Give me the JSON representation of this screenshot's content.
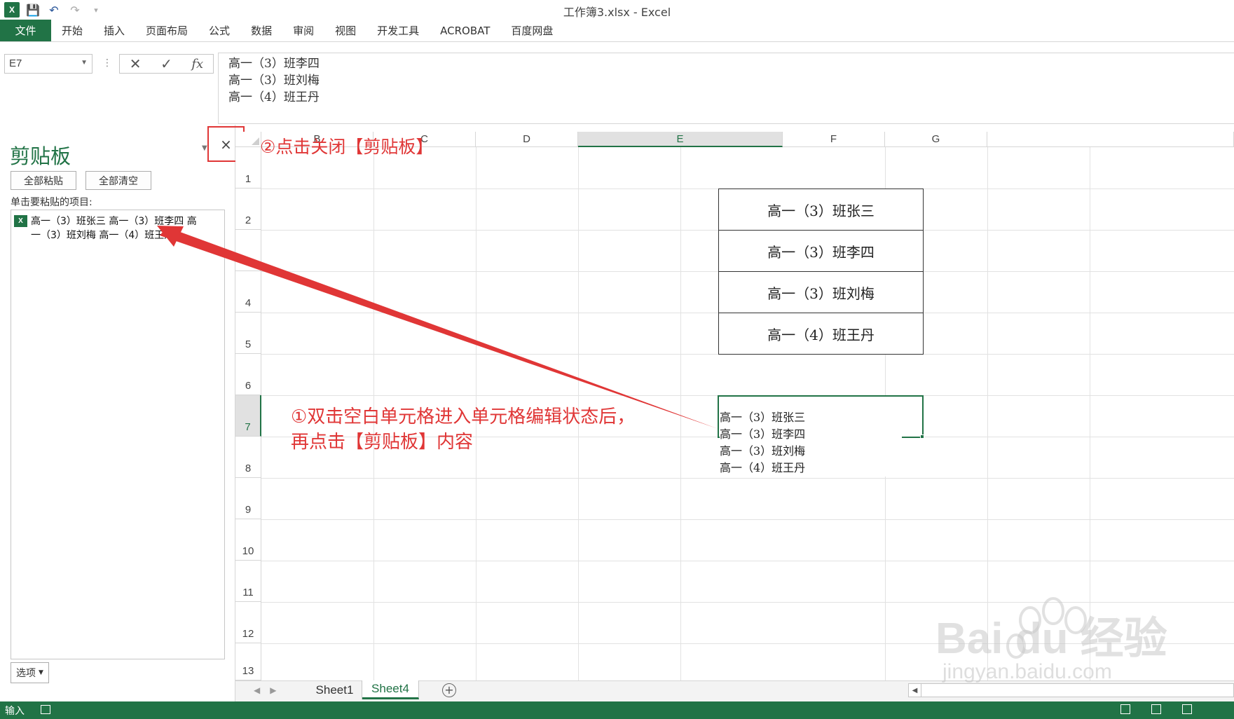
{
  "window": {
    "title": "工作簿3.xlsx - Excel",
    "app_icon": "excel-icon",
    "quick_access": [
      "save-icon",
      "undo-icon",
      "redo-icon",
      "customize-qat-icon"
    ]
  },
  "ribbon": {
    "file_label": "文件",
    "tabs": [
      "开始",
      "插入",
      "页面布局",
      "公式",
      "数据",
      "审阅",
      "视图",
      "开发工具",
      "ACROBAT",
      "百度网盘"
    ]
  },
  "formula_bar": {
    "name_box": "E7",
    "fx_label": "fx",
    "lines": [
      "高一（3）班李四",
      "高一（3）班刘梅",
      "高一（4）班王丹"
    ]
  },
  "clipboard_pane": {
    "title": "剪贴板",
    "close_glyph": "×",
    "paste_all_label": "全部粘贴",
    "clear_all_label": "全部清空",
    "hint": "单击要粘贴的项目:",
    "items": [
      {
        "text": "高一（3）班张三 高一（3）班李四 高一（3）班刘梅 高一（4）班王丹"
      }
    ],
    "options_label": "选项"
  },
  "grid": {
    "columns": [
      "B",
      "C",
      "D",
      "E",
      "F",
      "G"
    ],
    "selected_column": "E",
    "rows": [
      "1",
      "2",
      "3",
      "4",
      "5",
      "6",
      "7",
      "8",
      "9",
      "10",
      "11",
      "12",
      "13"
    ],
    "selected_row": "7",
    "bordered_cells": [
      {
        "ref": "E2",
        "value": "高一（3）班张三"
      },
      {
        "ref": "E3",
        "value": "高一（3）班李四"
      },
      {
        "ref": "E4",
        "value": "高一（3）班刘梅"
      },
      {
        "ref": "E5",
        "value": "高一（4）班王丹"
      }
    ],
    "active_cell": {
      "ref": "E7",
      "lines": [
        "高一（3）班张三",
        "高一（3）班李四",
        "高一（3）班刘梅",
        "高一（4）班王丹"
      ]
    }
  },
  "sheets": {
    "tabs": [
      "Sheet1",
      "Sheet4"
    ],
    "active": "Sheet4",
    "add_glyph": "+"
  },
  "status": {
    "mode": "输入"
  },
  "annotations": {
    "close_label": "②点击关闭【剪贴板】",
    "step1_line1": "①双击空白单元格进入单元格编辑状态后，",
    "step1_line2": "再点击【剪贴板】内容",
    "color": "#e03636"
  },
  "watermark": {
    "brand": "Bai du 经验",
    "url": "jingyan.baidu.com"
  }
}
